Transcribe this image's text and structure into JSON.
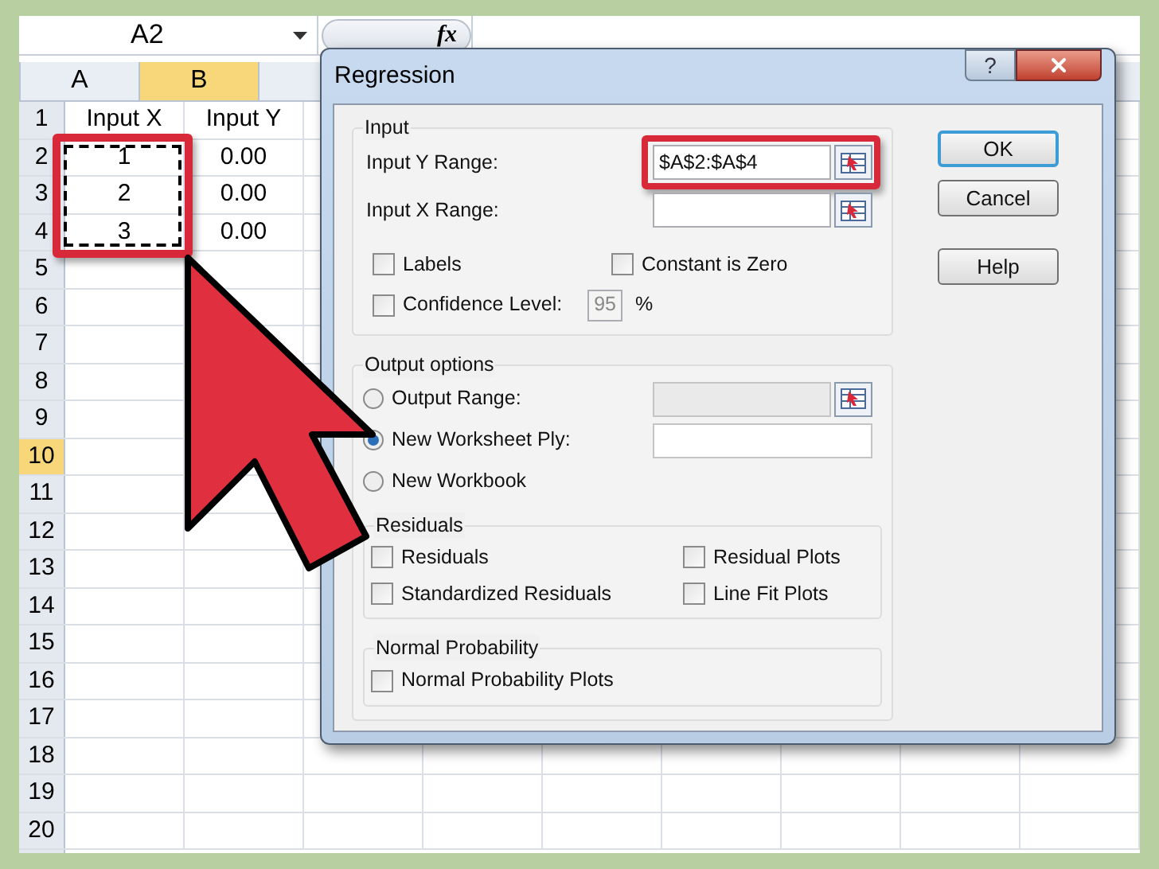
{
  "name_box": "A2",
  "formula_label": "fx",
  "sheet": {
    "selection_highlighted": true,
    "columns": [
      {
        "label": "A",
        "selected": false
      },
      {
        "label": "B",
        "selected": true
      }
    ],
    "rows": [
      {
        "label": "1",
        "selected": false,
        "cells": [
          "Input X",
          "Input Y"
        ]
      },
      {
        "label": "2",
        "selected": false,
        "cells": [
          "1",
          "0.00"
        ]
      },
      {
        "label": "3",
        "selected": false,
        "cells": [
          "2",
          "0.00"
        ]
      },
      {
        "label": "4",
        "selected": false,
        "cells": [
          "3",
          "0.00"
        ]
      },
      {
        "label": "5",
        "selected": false,
        "cells": []
      },
      {
        "label": "6",
        "selected": false,
        "cells": []
      },
      {
        "label": "7",
        "selected": false,
        "cells": []
      },
      {
        "label": "8",
        "selected": false,
        "cells": []
      },
      {
        "label": "9",
        "selected": false,
        "cells": []
      },
      {
        "label": "10",
        "selected": true,
        "cells": []
      },
      {
        "label": "11",
        "selected": false,
        "cells": []
      },
      {
        "label": "12",
        "selected": false,
        "cells": []
      },
      {
        "label": "13",
        "selected": false,
        "cells": []
      },
      {
        "label": "14",
        "selected": false,
        "cells": []
      },
      {
        "label": "15",
        "selected": false,
        "cells": []
      },
      {
        "label": "16",
        "selected": false,
        "cells": []
      },
      {
        "label": "17",
        "selected": false,
        "cells": []
      },
      {
        "label": "18",
        "selected": false,
        "cells": []
      },
      {
        "label": "19",
        "selected": false,
        "cells": []
      },
      {
        "label": "20",
        "selected": false,
        "cells": []
      }
    ]
  },
  "dialog": {
    "title": "Regression",
    "help_glyph": "?",
    "input": {
      "title": "Input",
      "fields": [
        {
          "label": "Input Y Range:",
          "value": "$A$2:$A$4",
          "highlighted": true
        },
        {
          "label": "Input X Range:",
          "highlighted": false
        }
      ],
      "checkboxes": [
        {
          "label": "Labels",
          "checked": false
        },
        {
          "label": "Constant is Zero",
          "checked": false
        },
        {
          "label": "Confidence Level:",
          "checked": false,
          "value": "95",
          "unit": "%"
        }
      ]
    },
    "output": {
      "title": "Output options",
      "radios": [
        {
          "label": "Output Range:",
          "selected": false,
          "field_disabled": true
        },
        {
          "label": "New Worksheet Ply:",
          "selected": true,
          "field_disabled": false
        },
        {
          "label": "New Workbook",
          "selected": false
        }
      ],
      "residuals": {
        "title": "Residuals",
        "checkboxes": [
          {
            "label": "Residuals",
            "checked": false
          },
          {
            "label": "Residual Plots",
            "checked": false
          },
          {
            "label": "Standardized Residuals",
            "checked": false
          },
          {
            "label": "Line Fit Plots",
            "checked": false
          }
        ]
      },
      "normal": {
        "title": "Normal Probability",
        "checkboxes": [
          {
            "label": "Normal Probability Plots",
            "checked": false
          }
        ]
      }
    },
    "buttons": [
      {
        "label": "OK",
        "default": true
      },
      {
        "label": "Cancel",
        "default": false
      },
      {
        "label": "Help",
        "default": false
      }
    ]
  }
}
